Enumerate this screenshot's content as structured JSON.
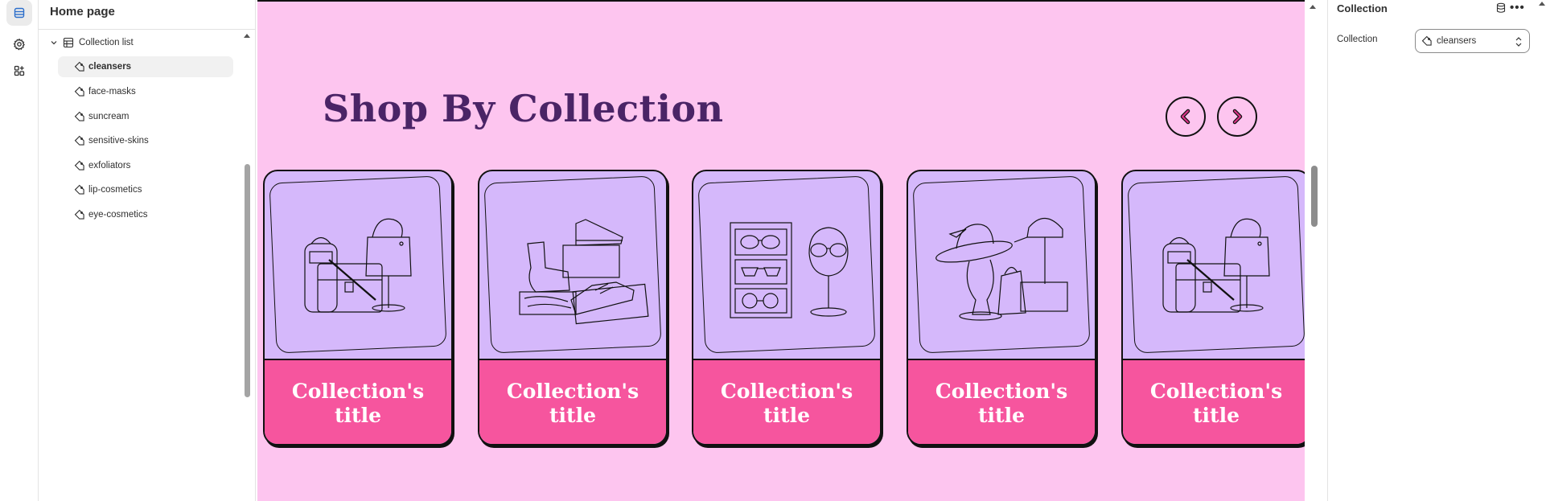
{
  "sidebar": {
    "title": "Home page",
    "tree_root_label": "Collection list",
    "items": [
      {
        "label": "cleansers",
        "selected": true
      },
      {
        "label": "face-masks",
        "selected": false
      },
      {
        "label": "suncream",
        "selected": false
      },
      {
        "label": "sensitive-skins",
        "selected": false
      },
      {
        "label": "exfoliators",
        "selected": false
      },
      {
        "label": "lip-cosmetics",
        "selected": false
      },
      {
        "label": "eye-cosmetics",
        "selected": false
      }
    ]
  },
  "rail": {
    "icons": [
      "sections-icon",
      "settings-gear-icon",
      "apps-icon"
    ]
  },
  "preview": {
    "heading": "Shop By Collection",
    "prev_icon": "chevron-left-icon",
    "next_icon": "chevron-right-icon",
    "cards": [
      {
        "title": "Collection's title",
        "illustration": "bags-illustration"
      },
      {
        "title": "Collection's title",
        "illustration": "shoes-illustration"
      },
      {
        "title": "Collection's title",
        "illustration": "glasses-illustration"
      },
      {
        "title": "Collection's title",
        "illustration": "hats-illustration"
      },
      {
        "title": "Collection's title",
        "illustration": "bags-illustration"
      }
    ],
    "colors": {
      "background": "#fdc5ef",
      "heading": "#4a2466",
      "card_top": "#d5b8fb",
      "card_bottom": "#f6559e",
      "arrow_accent": "#e0338a"
    }
  },
  "right_panel": {
    "title": "Collection",
    "field_label": "Collection",
    "select_value": "cleansers",
    "more_label": "•••"
  }
}
